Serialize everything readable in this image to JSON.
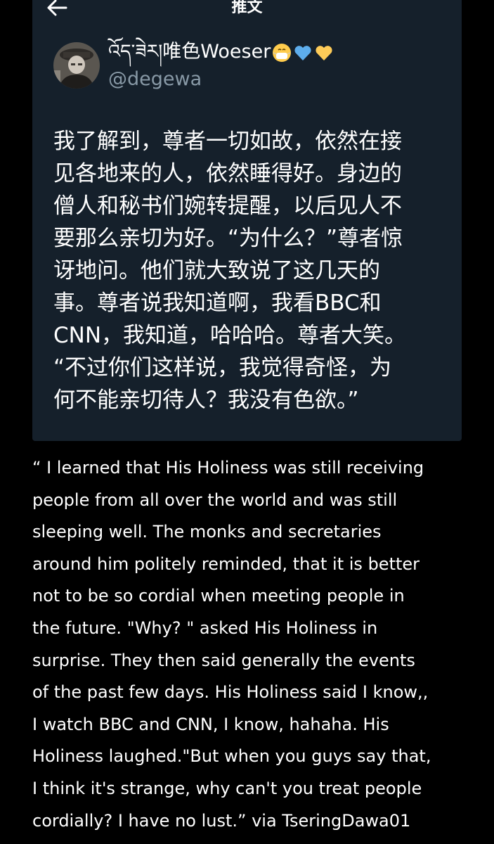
{
  "header": {
    "title": "推文",
    "back_icon": "arrow-left-icon"
  },
  "tweet": {
    "display_name": "འོད་ཟེར།唯色Woeser",
    "emojis": [
      "mask-face-emoji",
      "blue-heart-emoji",
      "yellow-heart-emoji"
    ],
    "handle": "@degewa",
    "text_lines": [
      "我了解到，尊者一切如故，依然在接",
      "见各地来的人，依然睡得好。身边的",
      "僧人和秘书们婉转提醒，以后见人不",
      "要那么亲切为好。“为什么？”尊者惊",
      "讶地问。他们就大致说了这几天的",
      "事。尊者说我知道啊，我看BBC和",
      "CNN，我知道，哈哈哈。尊者大笑。",
      "“不过你们这样说，我觉得奇怪，为",
      "何不能亲切待人？我没有色欲。”"
    ]
  },
  "translation": {
    "lines": [
      "“ I learned that His Holiness was still receiving",
      "people from all over the world and was still",
      "sleeping well. The monks and secretaries",
      "around him politely reminded, that it is better",
      "not to be so cordial when meeting people in",
      "the future. \"Why? \" asked His Holiness in",
      "surprise. They then said generally the events",
      "of the past few days. His Holiness said I know,,",
      "I watch BBC and CNN, I know, hahaha. His",
      "Holiness laughed.\"But when you guys say that,",
      "I think it's strange, why can't you treat people",
      "cordially? I have no lust.” via TseringDawa01"
    ]
  },
  "colors": {
    "page_background": "#000000",
    "card_background": "#15202b",
    "primary_text": "#ffffff",
    "secondary_text": "#8899a6"
  }
}
